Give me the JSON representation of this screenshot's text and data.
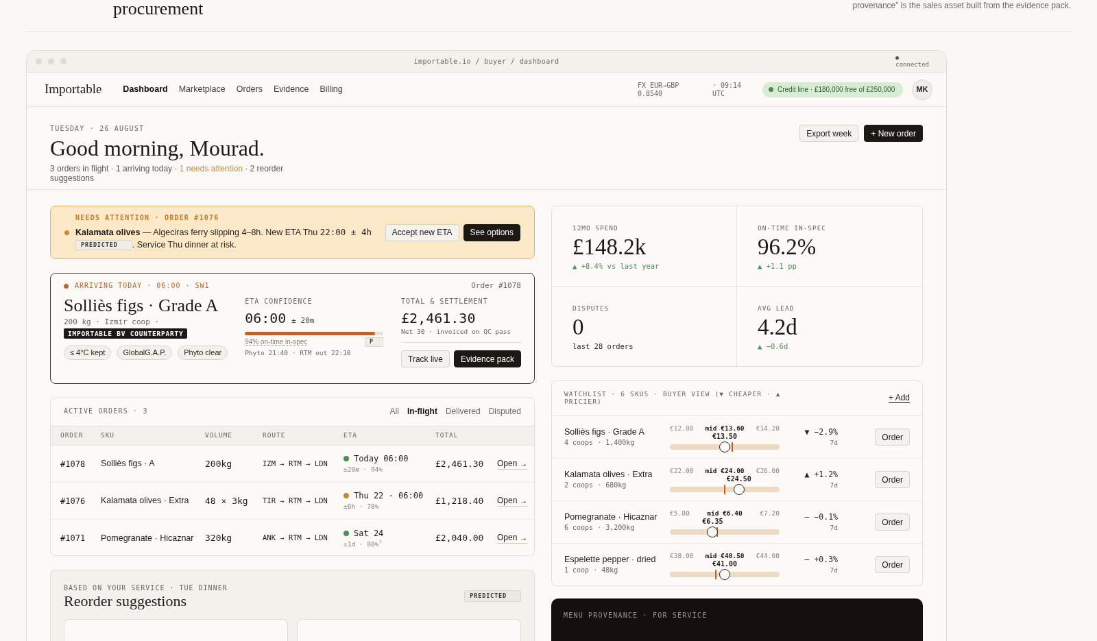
{
  "page_header": {
    "title": "procurement",
    "note": "provenance\" is the sales asset built from the evidence pack."
  },
  "browser": {
    "url": "importable.io / buyer / dashboard",
    "status": "connected"
  },
  "nav": {
    "brand": "Importable",
    "links": [
      {
        "label": "Dashboard",
        "selected": true
      },
      {
        "label": "Marketplace",
        "selected": false
      },
      {
        "label": "Orders",
        "selected": false
      },
      {
        "label": "Evidence",
        "selected": false
      },
      {
        "label": "Billing",
        "selected": false
      }
    ],
    "fx": "FX EUR→GBP 0.8540",
    "time": "· 09:14 UTC",
    "credit": "Credit line · £180,000 free of £250,000",
    "avatar": "MK"
  },
  "greeting": {
    "date": "TUESDAY · 26 AUGUST",
    "title": "Good morning, Mourad.",
    "summary": [
      {
        "kind": "plain",
        "text": "3 orders in flight · 1 arriving today · "
      },
      {
        "kind": "alert",
        "text": "1 needs attention"
      },
      {
        "kind": "plain",
        "text": " · 2 reorder suggestions"
      }
    ],
    "actions": [
      {
        "label": "Export week",
        "kind": "secondary"
      },
      {
        "label": "+ New order",
        "kind": "primary"
      }
    ]
  },
  "attention": {
    "label": "NEEDS ATTENTION · ORDER #1076",
    "message": [
      {
        "kind": "strong",
        "text": "Kalamata olives"
      },
      {
        "kind": "plain",
        "text": " — Algeciras ferry slipping 4–8h. New ETA Thu "
      },
      {
        "kind": "mono",
        "text": "22:00 ± 4h"
      }
    ],
    "badge": "PREDICTED",
    "message_end": ". Service Thu dinner at risk.",
    "actions": [
      {
        "label": "Accept new ETA",
        "kind": "secondary"
      },
      {
        "label": "See options",
        "kind": "primary"
      }
    ]
  },
  "arrival": {
    "label": "ARRIVING TODAY · 06:00 · SW1",
    "order": "Order #1078",
    "title": "Solliès figs · Grade A",
    "meta": "200 kg · Izmir coop ·",
    "counterparty": "IMPORTABLE BV COUNTERPARTY",
    "chips": [
      "≤ 4°C kept",
      "GlobalG.A.P.",
      "Phyto clear"
    ],
    "eta": {
      "label": "ETA CONFIDENCE",
      "time": "06:00",
      "margin": "± 20m",
      "level": 0.94,
      "chip": "P",
      "note": "94% on-time in-spec",
      "schedule": "Phyto 21:40 · RTM out 22:10"
    },
    "total": {
      "label": "TOTAL & SETTLEMENT",
      "amount": "£2,461.30",
      "terms": "Net 30 · invoiced on QC pass"
    },
    "actions": [
      {
        "label": "Track live",
        "kind": "secondary"
      },
      {
        "label": "Evidence pack",
        "kind": "primary"
      }
    ]
  },
  "orders": {
    "title": "ACTIVE ORDERS · 3",
    "filters": [
      {
        "label": "All",
        "selected": false
      },
      {
        "label": "In-flight",
        "selected": true
      },
      {
        "label": "Delivered",
        "selected": false
      },
      {
        "label": "Disputed",
        "selected": false
      }
    ],
    "columns": [
      "ORDER",
      "SKU",
      "VOLUME",
      "ROUTE",
      "ETA",
      "TOTAL"
    ],
    "rows": [
      {
        "order": "#1078",
        "sku": "Solliès figs · A",
        "volume": "200kg",
        "route": "IZM → RTM → LDN",
        "eta": "Today 06:00",
        "eta_detail": "±20m · 94%",
        "color": "#4e8a5a",
        "total": "£2,461.30",
        "action": "Open →"
      },
      {
        "order": "#1076",
        "sku": "Kalamata olives · Extra",
        "volume": "48 × 3kg",
        "route": "TIR → RTM → LDN",
        "eta": "Thu 22 · 06:00",
        "eta_detail": "±6h · 78%",
        "color": "#c98a3e",
        "total": "£1,218.40",
        "action": "Open →"
      },
      {
        "order": "#1071",
        "sku": "Pomegranate · Hicaznar",
        "volume": "320kg",
        "route": "ANK → RTM → LDN",
        "eta": "Sat 24",
        "eta_detail": "±1d · 88%$^{?}$",
        "color": "#4e8a5a",
        "total": "£2,040.00",
        "action": "Open →"
      }
    ]
  },
  "reorder": {
    "label": "BASED ON YOUR SERVICE · TUE DINNER",
    "title": "Reorder suggestions",
    "badge": "PREDICTED"
  },
  "kpis": [
    {
      "label": "12MO SPEND",
      "value": "£148.2k",
      "delta": "▲ +8.4% vs last year",
      "kind": "positive"
    },
    {
      "label": "ON-TIME IN-SPEC",
      "value": "96.2%",
      "delta": "▲ +1.1 pp",
      "kind": "positive"
    },
    {
      "label": "DISPUTES",
      "value": "0",
      "delta": "last 28 orders",
      "kind": "neutral"
    },
    {
      "label": "AVG LEAD",
      "value": "4.2d",
      "delta": "▲ −0.6d",
      "kind": "positive"
    }
  ],
  "watchlist": {
    "title": "WATCHLIST · 6 SKUS · BUYER VIEW (▼ CHEAPER · ▲ PRICIER)",
    "add": "+ Add",
    "rows": [
      {
        "name": "Solliès figs · Grade A",
        "meta": "4 coops · 1,400kg",
        "min": "€12.80",
        "mid_label": "mid €13.60",
        "max": "€14.20",
        "current": "€13.50",
        "level": 0.5,
        "mid": {
          "level": 0.57
        },
        "change": "▼ −2.9%",
        "period": "7d",
        "action": "Order"
      },
      {
        "name": "Kalamata olives · Extra",
        "meta": "2 coops · 680kg",
        "min": "€22.00",
        "mid_label": "mid €24.00",
        "max": "€26.00",
        "current": "€24.50",
        "level": 0.63,
        "mid": {
          "level": 0.5
        },
        "change": "▲ +1.2%",
        "period": "7d",
        "action": "Order"
      },
      {
        "name": "Pomegranate · Hicaznar",
        "meta": "6 coops · 3,200kg",
        "min": "€5.80",
        "mid_label": "mid €6.40",
        "max": "€7.20",
        "current": "€6.35",
        "level": 0.39,
        "mid": {
          "level": 0.43
        },
        "change": "— −0.1%",
        "period": "7d",
        "action": "Order"
      },
      {
        "name": "Espelette pepper · dried",
        "meta": "1 coop · 48kg",
        "min": "€38.00",
        "mid_label": "mid €40.50",
        "max": "€44.00",
        "current": "€41.00",
        "level": 0.5,
        "mid": {
          "level": 0.42
        },
        "change": "— +0.3%",
        "period": "7d",
        "action": "Order"
      }
    ]
  },
  "provenance": {
    "label": "MENU PROVENANCE · FOR SERVICE"
  }
}
